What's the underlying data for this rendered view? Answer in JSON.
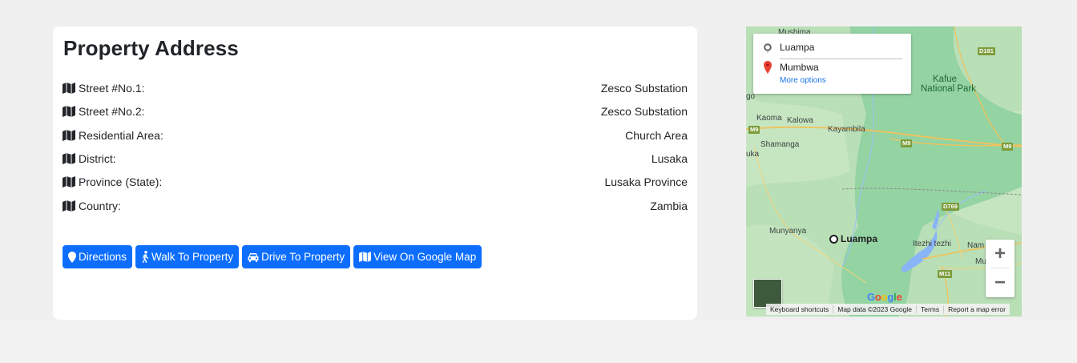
{
  "address": {
    "title": "Property Address",
    "rows": [
      {
        "label": "Street #No.1:",
        "value": "Zesco Substation"
      },
      {
        "label": "Street #No.2:",
        "value": "Zesco Substation"
      },
      {
        "label": "Residential Area:",
        "value": "Church Area"
      },
      {
        "label": "District:",
        "value": "Lusaka"
      },
      {
        "label": "Province (State):",
        "value": "Lusaka Province"
      },
      {
        "label": "Country:",
        "value": "Zambia"
      }
    ],
    "row_icon": "map-icon",
    "buttons": [
      {
        "label": "Directions",
        "icon": "map-marker-icon"
      },
      {
        "label": "Walk To Property",
        "icon": "walking-icon"
      },
      {
        "label": "Drive To Property",
        "icon": "car-icon"
      },
      {
        "label": "View On Google Map",
        "icon": "map-icon"
      }
    ],
    "accent_color": "#0d6efd"
  },
  "map": {
    "origin": "Luampa",
    "destination": "Mumbwa",
    "more_options": "More options",
    "place_labels": {
      "mushima": "Mushima",
      "kafue_national_park_1": "Kafue",
      "kafue_national_park_2": "National Park",
      "kaoma": "Kaoma",
      "kalowa": "Kalowa",
      "kayambila": "Kayambila",
      "shamanga": "Shamanga",
      "uka": "uka",
      "go": "go",
      "munyanya": "Munyanya",
      "itezhi_tezhi": "Itezhi tezhi",
      "nam": "Nam",
      "mu": "Mu"
    },
    "road_labels": {
      "d181": "D181",
      "m9_left": "M9",
      "m9_mid": "M9",
      "m9_right": "M9",
      "d769": "D769",
      "m11": "M11"
    },
    "marker_label": "Luampa",
    "zoom_in": "+",
    "zoom_out": "−",
    "logo": "Google",
    "attribution": {
      "shortcuts": "Keyboard shortcuts",
      "data": "Map data ©2023 Google",
      "terms": "Terms",
      "report": "Report a map error"
    }
  }
}
